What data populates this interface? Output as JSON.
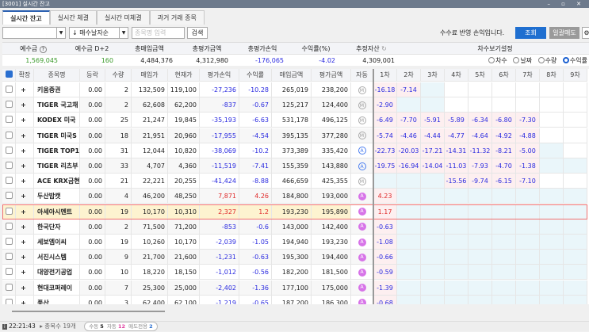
{
  "window": {
    "title": "[3001] 실시간 잔고",
    "controls": "– ▫ ✕"
  },
  "tabs": [
    "실시간 잔고",
    "실시간 체결",
    "실시간 미체결",
    "과거 거래 종목"
  ],
  "toolbar": {
    "account_value": "",
    "sort_value": "↓ 매수날자순",
    "search_placeholder": "종목명 입력",
    "search_label": "검색",
    "fee_notice": "수수료 반영 손익입니다.",
    "query_label": "조회",
    "sell_all_label": "일괄매도",
    "gear": "⚙"
  },
  "summary": {
    "headers": [
      "예수금",
      "예수금 D+2",
      "총매입금액",
      "총평가금액",
      "총평가손익",
      "수익률(%)",
      "추정자산",
      "차수보기설정"
    ],
    "values": [
      "1,569,045",
      "160",
      "4,484,376",
      "4,312,980",
      "-176,065",
      "-4.02",
      "4,309,001"
    ],
    "view_options": [
      "차수",
      "날짜",
      "수량",
      "수익률"
    ],
    "view_selected": 3
  },
  "grid": {
    "headers": [
      "확장",
      "종목명",
      "등락",
      "수량",
      "매입가",
      "현재가",
      "평가손익",
      "수익률",
      "매입금액",
      "평가금액",
      "자동",
      "1차",
      "2차",
      "3차",
      "4차",
      "5차",
      "6차",
      "7차",
      "8차",
      "9차"
    ],
    "rows": [
      {
        "name": "키움증권",
        "chg": "0.00",
        "qty": "2",
        "buy": "132,509",
        "cur": "119,100",
        "pl": "-27,236",
        "rate": "-10.28",
        "buyamt": "265,019",
        "evalamt": "238,200",
        "auto": "M",
        "steps": [
          "-16.18",
          "-7.14",
          "",
          "",
          "",
          "",
          "",
          "",
          ""
        ],
        "cells": "ppbwwwwww"
      },
      {
        "name": "TIGER 국고채",
        "chg": "0.00",
        "qty": "2",
        "buy": "62,608",
        "cur": "62,200",
        "pl": "-837",
        "rate": "-0.67",
        "buyamt": "125,217",
        "evalamt": "124,400",
        "auto": "M",
        "steps": [
          "-2.90",
          "",
          "",
          "",
          "",
          "",
          "",
          "",
          ""
        ],
        "cells": "pbbwwwwww"
      },
      {
        "name": "KODEX 미국",
        "chg": "0.00",
        "qty": "25",
        "buy": "21,247",
        "cur": "19,845",
        "pl": "-35,193",
        "rate": "-6.63",
        "buyamt": "531,178",
        "evalamt": "496,125",
        "auto": "M",
        "steps": [
          "-6.49",
          "-7.70",
          "-5.91",
          "-5.89",
          "-6.34",
          "-6.80",
          "-7.30",
          "",
          ""
        ],
        "cells": "pppppppww"
      },
      {
        "name": "TIGER 미국S",
        "chg": "0.00",
        "qty": "18",
        "buy": "21,951",
        "cur": "20,960",
        "pl": "-17,955",
        "rate": "-4.54",
        "buyamt": "395,135",
        "evalamt": "377,280",
        "auto": "M",
        "steps": [
          "-5.74",
          "-4.46",
          "-4.44",
          "-4.77",
          "-4.64",
          "-4.92",
          "-4.88",
          "",
          ""
        ],
        "cells": "pppppppww"
      },
      {
        "name": "TIGER TOP1",
        "chg": "0.00",
        "qty": "31",
        "buy": "12,044",
        "cur": "10,820",
        "pl": "-38,069",
        "rate": "-10.2",
        "buyamt": "373,389",
        "evalamt": "335,420",
        "auto": "A",
        "steps": [
          "-22.73",
          "-20.03",
          "-17.21",
          "-14.31",
          "-11.32",
          "-8.21",
          "-5.00",
          "",
          ""
        ],
        "cells": "pppppppbw"
      },
      {
        "name": "TIGER 리츠부",
        "chg": "0.00",
        "qty": "33",
        "buy": "4,707",
        "cur": "4,360",
        "pl": "-11,519",
        "rate": "-7.41",
        "buyamt": "155,359",
        "evalamt": "143,880",
        "auto": "A",
        "steps": [
          "-19.75",
          "-16.94",
          "-14.04",
          "-11.03",
          "-7.93",
          "-4.70",
          "-1.38",
          "",
          ""
        ],
        "cells": "pppppppbb"
      },
      {
        "name": "ACE KRX금현",
        "chg": "0.00",
        "qty": "21",
        "buy": "22,221",
        "cur": "20,255",
        "pl": "-41,424",
        "rate": "-8.88",
        "buyamt": "466,659",
        "evalamt": "425,355",
        "auto": "M",
        "steps": [
          "",
          "",
          "",
          "-15.56",
          "-9.74",
          "-6.15",
          "-7.10",
          "",
          ""
        ],
        "cells": "bbbppppww"
      },
      {
        "name": "두산밥캣",
        "chg": "0.00",
        "qty": "4",
        "buy": "46,200",
        "cur": "48,250",
        "pl": "7,871",
        "rate": "4.26",
        "buyamt": "184,800",
        "evalamt": "193,000",
        "auto": "P",
        "steps": [
          "4.23",
          "",
          "",
          "",
          "",
          "",
          "",
          "",
          ""
        ],
        "cells": "pbbbbbbbb"
      },
      {
        "name": "아세아시멘트",
        "chg": "0.00",
        "qty": "19",
        "buy": "10,170",
        "cur": "10,310",
        "pl": "2,327",
        "rate": "1.2",
        "buyamt": "193,230",
        "evalamt": "195,890",
        "auto": "P",
        "steps": [
          "1.17",
          "",
          "",
          "",
          "",
          "",
          "",
          "",
          ""
        ],
        "cells": "pbbbbbbbb",
        "selected": true
      },
      {
        "name": "한국단자",
        "chg": "0.00",
        "qty": "2",
        "buy": "71,500",
        "cur": "71,200",
        "pl": "-853",
        "rate": "-0.6",
        "buyamt": "143,000",
        "evalamt": "142,400",
        "auto": "P",
        "steps": [
          "-0.63",
          "",
          "",
          "",
          "",
          "",
          "",
          "",
          ""
        ],
        "cells": "pbbbbbbbb"
      },
      {
        "name": "세보엠이씨",
        "chg": "0.00",
        "qty": "19",
        "buy": "10,260",
        "cur": "10,170",
        "pl": "-2,039",
        "rate": "-1.05",
        "buyamt": "194,940",
        "evalamt": "193,230",
        "auto": "P",
        "steps": [
          "-1.08",
          "",
          "",
          "",
          "",
          "",
          "",
          "",
          ""
        ],
        "cells": "pbbbbbbbb"
      },
      {
        "name": "서진시스템",
        "chg": "0.00",
        "qty": "9",
        "buy": "21,700",
        "cur": "21,600",
        "pl": "-1,231",
        "rate": "-0.63",
        "buyamt": "195,300",
        "evalamt": "194,400",
        "auto": "P",
        "steps": [
          "-0.66",
          "",
          "",
          "",
          "",
          "",
          "",
          "",
          ""
        ],
        "cells": "pbbbbbbbb"
      },
      {
        "name": "대양전기공업",
        "chg": "0.00",
        "qty": "10",
        "buy": "18,220",
        "cur": "18,150",
        "pl": "-1,012",
        "rate": "-0.56",
        "buyamt": "182,200",
        "evalamt": "181,500",
        "auto": "P",
        "steps": [
          "-0.59",
          "",
          "",
          "",
          "",
          "",
          "",
          "",
          ""
        ],
        "cells": "pbbbbbbbb"
      },
      {
        "name": "현대코퍼레이",
        "chg": "0.00",
        "qty": "7",
        "buy": "25,300",
        "cur": "25,000",
        "pl": "-2,402",
        "rate": "-1.36",
        "buyamt": "177,100",
        "evalamt": "175,000",
        "auto": "P",
        "steps": [
          "-1.39",
          "",
          "",
          "",
          "",
          "",
          "",
          "",
          ""
        ],
        "cells": "pbbbbbbbb"
      },
      {
        "name": "풍산",
        "chg": "0.00",
        "qty": "3",
        "buy": "62,400",
        "cur": "62,100",
        "pl": "-1,219",
        "rate": "-0.65",
        "buyamt": "187,200",
        "evalamt": "186,300",
        "auto": "P",
        "steps": [
          "-0.68",
          "",
          "",
          "",
          "",
          "",
          "",
          "",
          ""
        ],
        "cells": "pbbbbbbbb"
      }
    ]
  },
  "status": {
    "time": "22:21:43",
    "count": "▸ 종목수 19개",
    "manual_label": "수동",
    "manual": "5",
    "auto_label": "자동",
    "auto": "12",
    "sellonly_label": "매도전용",
    "sellonly": "2"
  }
}
